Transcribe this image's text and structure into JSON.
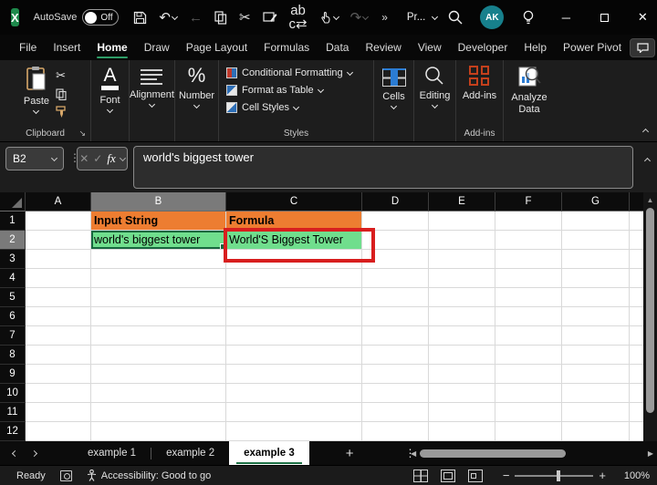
{
  "colors": {
    "accent_green": "#2e9e67",
    "orange_fill": "#ED7D31",
    "green_fill": "#70DE8D",
    "red_annotation": "#d81e1e",
    "selection_green": "#17683f"
  },
  "titlebar": {
    "autosave_label": "AutoSave",
    "autosave_state": "Off",
    "doc_title": "Pr...",
    "avatar_initials": "AK",
    "overflow": "»"
  },
  "ribbon_tabs": [
    {
      "label": "File",
      "active": false
    },
    {
      "label": "Insert",
      "active": false
    },
    {
      "label": "Home",
      "active": true
    },
    {
      "label": "Draw",
      "active": false
    },
    {
      "label": "Page Layout",
      "active": false
    },
    {
      "label": "Formulas",
      "active": false
    },
    {
      "label": "Data",
      "active": false
    },
    {
      "label": "Review",
      "active": false
    },
    {
      "label": "View",
      "active": false
    },
    {
      "label": "Developer",
      "active": false
    },
    {
      "label": "Help",
      "active": false
    },
    {
      "label": "Power Pivot",
      "active": false
    }
  ],
  "ribbon": {
    "paste_label": "Paste",
    "clipboard_group": "Clipboard",
    "font_label": "Font",
    "alignment_label": "Alignment",
    "number_label": "Number",
    "styles_items": [
      "Conditional Formatting",
      "Format as Table",
      "Cell Styles"
    ],
    "styles_group": "Styles",
    "cells_label": "Cells",
    "editing_label": "Editing",
    "addins_label": "Add-ins",
    "addins_group": "Add-ins",
    "analyze_line1": "Analyze",
    "analyze_line2": "Data"
  },
  "formula_bar": {
    "name_box": "B2",
    "fx_label": "fx",
    "cancel_glyph": "✕",
    "enter_glyph": "✓",
    "formula": "world's biggest tower"
  },
  "grid": {
    "columns": [
      "A",
      "B",
      "C",
      "D",
      "E",
      "F",
      "G"
    ],
    "rows": [
      1,
      2,
      3,
      4,
      5,
      6,
      7,
      8,
      9,
      10,
      11,
      12
    ],
    "cells": [
      {
        "ref": "B1",
        "text": "Input String",
        "style": "orange"
      },
      {
        "ref": "C1",
        "text": "Formula",
        "style": "orange"
      },
      {
        "ref": "B2",
        "text": "world's biggest tower",
        "style": "green"
      },
      {
        "ref": "C2",
        "text": "World'S Biggest Tower",
        "style": "green"
      }
    ],
    "selected_cell": "B2",
    "selected_column": "B",
    "selected_row": 2,
    "annotation": {
      "target": "C2",
      "type": "red-box"
    }
  },
  "sheet_tabs": [
    {
      "label": "example 1",
      "active": false
    },
    {
      "label": "example 2",
      "active": false
    },
    {
      "label": "example 3",
      "active": true
    }
  ],
  "sheet_bar": {
    "add_label": "+",
    "more_dots": "⋮"
  },
  "status_bar": {
    "mode": "Ready",
    "accessibility": "Accessibility: Good to go",
    "zoom_level": "100%",
    "zoom_minus": "−",
    "zoom_plus": "+"
  }
}
